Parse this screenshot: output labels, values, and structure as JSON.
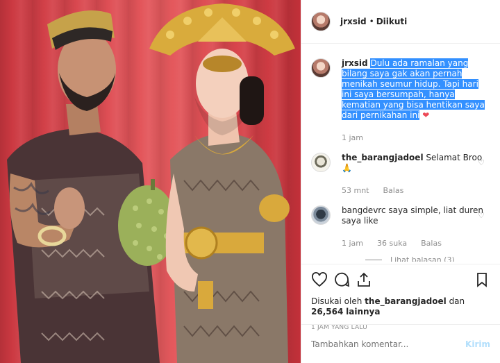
{
  "post": {
    "author": "jrxsid",
    "separator": "•",
    "follow_status": "Diikuti",
    "caption": {
      "user": "jrxsid",
      "text": "Dulu ada ramalan yang bilang saya gak akan pernah menikah seumur hidup. Tapi hari ini saya bersumpah, hanya kematian yang bisa hentikan saya dari pernikahan ini",
      "emoji": "❤",
      "time": "1 jam"
    },
    "comments": [
      {
        "user": "the_barangjadoel",
        "text": "Selamat Broo",
        "emoji": "🙏",
        "time": "53 mnt",
        "reply_label": "Balas"
      },
      {
        "user": "bangdevrc",
        "text": "saya simple, liat duren saya like",
        "time": "1 jam",
        "likes_label": "36 suka",
        "reply_label": "Balas",
        "view_replies": "Lihat balasan (3)"
      }
    ],
    "liked_by_prefix": "Disukai oleh",
    "liked_by_user": "the_barangjadoel",
    "liked_by_and": "dan",
    "likes_count": "26,564",
    "likes_suffix": "lainnya",
    "time_ago": "1 JAM YANG LALU",
    "comment_placeholder": "Tambahkan komentar...",
    "post_button": "Kirim"
  },
  "icons": {
    "like": "heart-icon",
    "comment": "comment-icon",
    "share": "share-icon",
    "save": "bookmark-icon"
  },
  "colors": {
    "highlight": "#3390ff",
    "heart": "#ed4956",
    "post_button_disabled": "#b2dffc"
  }
}
